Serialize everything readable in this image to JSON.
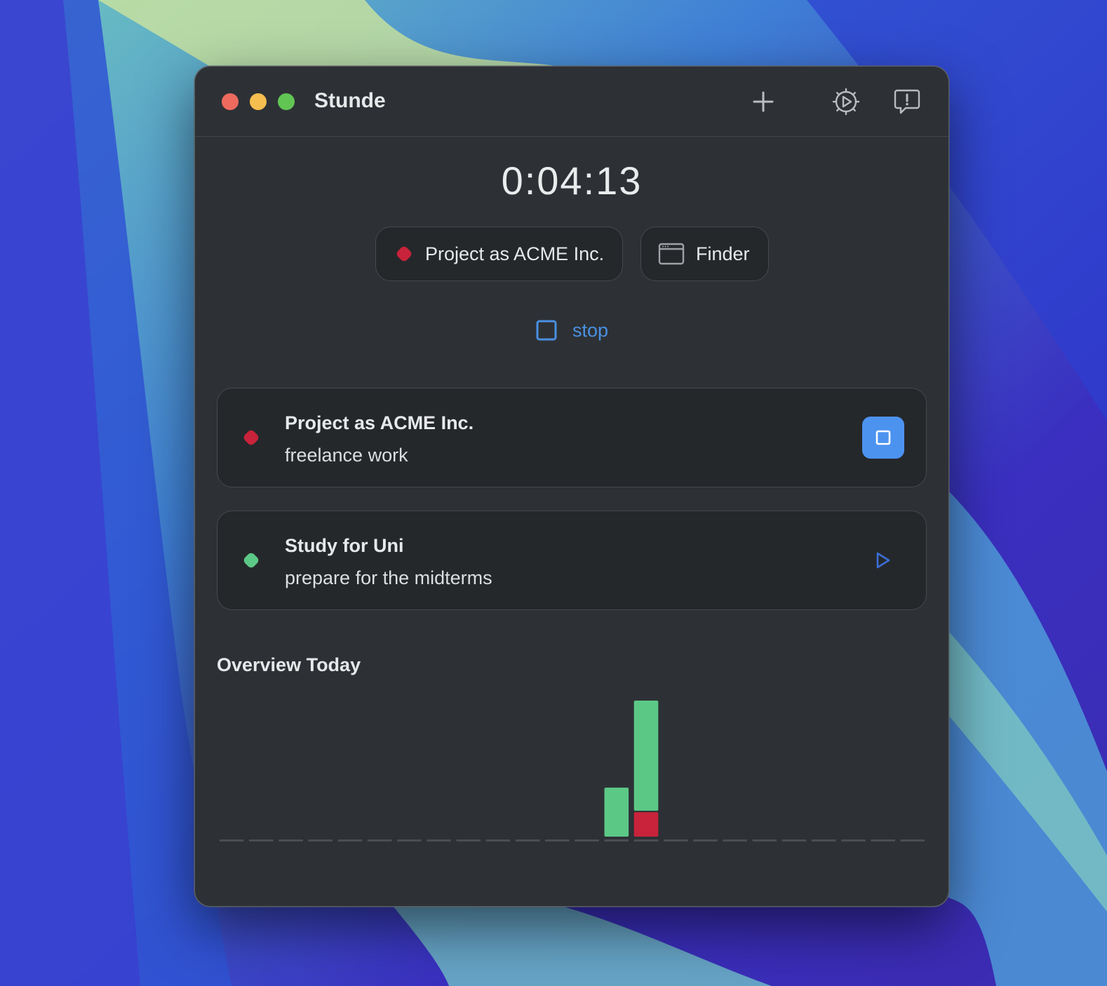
{
  "app": {
    "title": "Stunde"
  },
  "toolbar": {
    "add_icon": "plus-icon",
    "settings_icon": "gear-play-icon",
    "feedback_icon": "feedback-bubble-icon"
  },
  "timer": {
    "elapsed": "0:04:13"
  },
  "current": {
    "project_label": "Project as ACME Inc.",
    "project_color": "#c8233b",
    "app_label": "Finder",
    "app_icon": "window-icon",
    "stop_label": "stop"
  },
  "projects": [
    {
      "title": "Project as ACME Inc.",
      "subtitle": "freelance work",
      "color": "#c8233b",
      "state": "running"
    },
    {
      "title": "Study for Uni",
      "subtitle": "prepare for the midterms",
      "color": "#5cc886",
      "state": "idle"
    }
  ],
  "overview": {
    "title": "Overview Today"
  },
  "chart_data": {
    "type": "bar",
    "stacked": true,
    "slots": 24,
    "series": [
      {
        "color": "#c8233b",
        "values": [
          0,
          0,
          0,
          0,
          0,
          0,
          0,
          0,
          0,
          0,
          0,
          0,
          0,
          0,
          0.2,
          0,
          0,
          0,
          0,
          0,
          0,
          0,
          0,
          0
        ]
      },
      {
        "color": "#5cc886",
        "values": [
          0,
          0,
          0,
          0,
          0,
          0,
          0,
          0,
          0,
          0,
          0,
          0,
          0,
          0.4,
          0.9,
          0,
          0,
          0,
          0,
          0,
          0,
          0,
          0,
          0
        ]
      }
    ],
    "ylim": [
      0,
      1.1
    ],
    "grid": false
  }
}
